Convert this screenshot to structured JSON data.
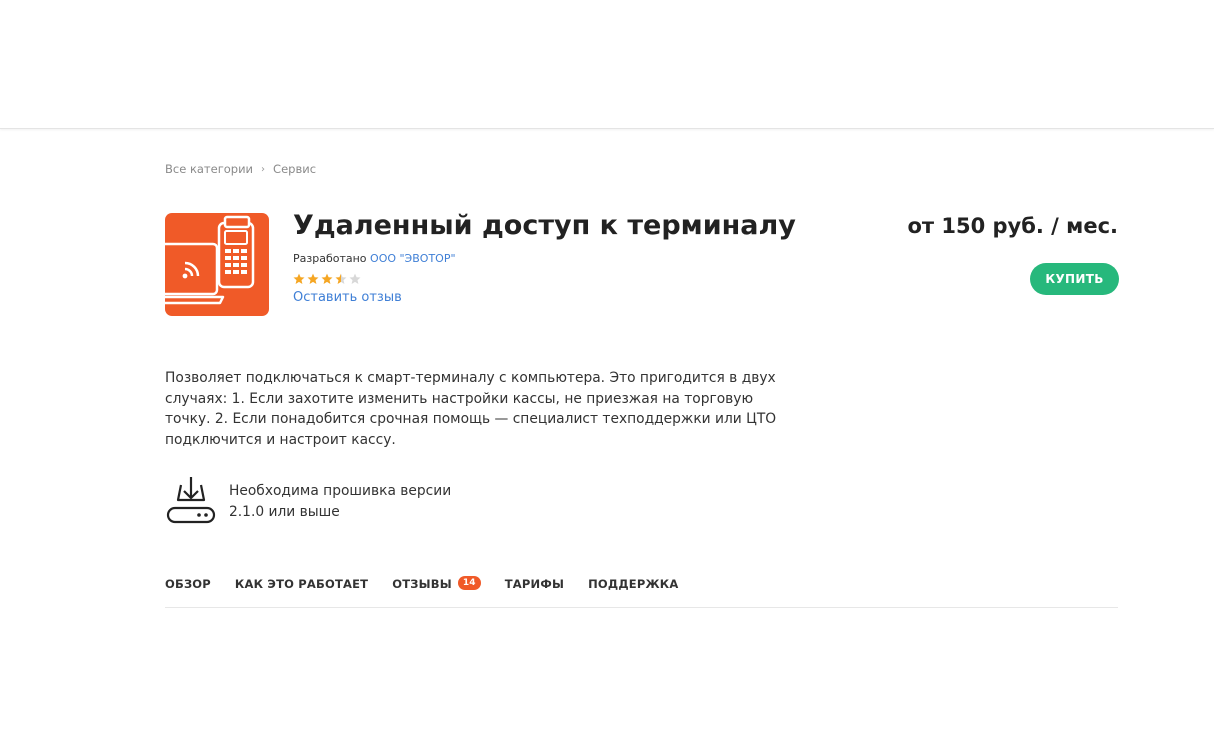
{
  "breadcrumb": {
    "items": [
      "Все категории",
      "Сервис"
    ],
    "separator": "›"
  },
  "app": {
    "title": "Удаленный доступ к терминалу",
    "developer_prefix": "Разработано",
    "developer_name": "ООО \"ЭВОТОР\"",
    "rating": 3.5,
    "rating_max": 5,
    "review_link": "Оставить отзыв",
    "icon": "laptop-terminal-remote-icon",
    "icon_color": "#f05a28"
  },
  "price": "от 150 руб. / мес.",
  "buy_button": "КУПИТЬ",
  "buy_color": "#27b87c",
  "description": "Позволяет подключаться к смарт-терминалу с компьютера. Это пригодится в двух случаях: 1. Если захотите изменить настройки кассы, не приезжая на торговую точку. 2. Если понадобится срочная помощь — специалист техподдержки или ЦТО подключится и настроит кассу.",
  "firmware": {
    "icon": "firmware-download-icon",
    "text": "Необходима прошивка версии 2.1.0 или выше"
  },
  "tabs": [
    {
      "label": "ОБЗОР"
    },
    {
      "label": "КАК ЭТО РАБОТАЕТ"
    },
    {
      "label": "ОТЗЫВЫ",
      "badge": "14"
    },
    {
      "label": "ТАРИФЫ"
    },
    {
      "label": "ПОДДЕРЖКА"
    }
  ],
  "colors": {
    "link": "#3f7fd6",
    "star_filled": "#f5a623",
    "star_empty": "#d8d8d8",
    "badge": "#f05a28"
  }
}
